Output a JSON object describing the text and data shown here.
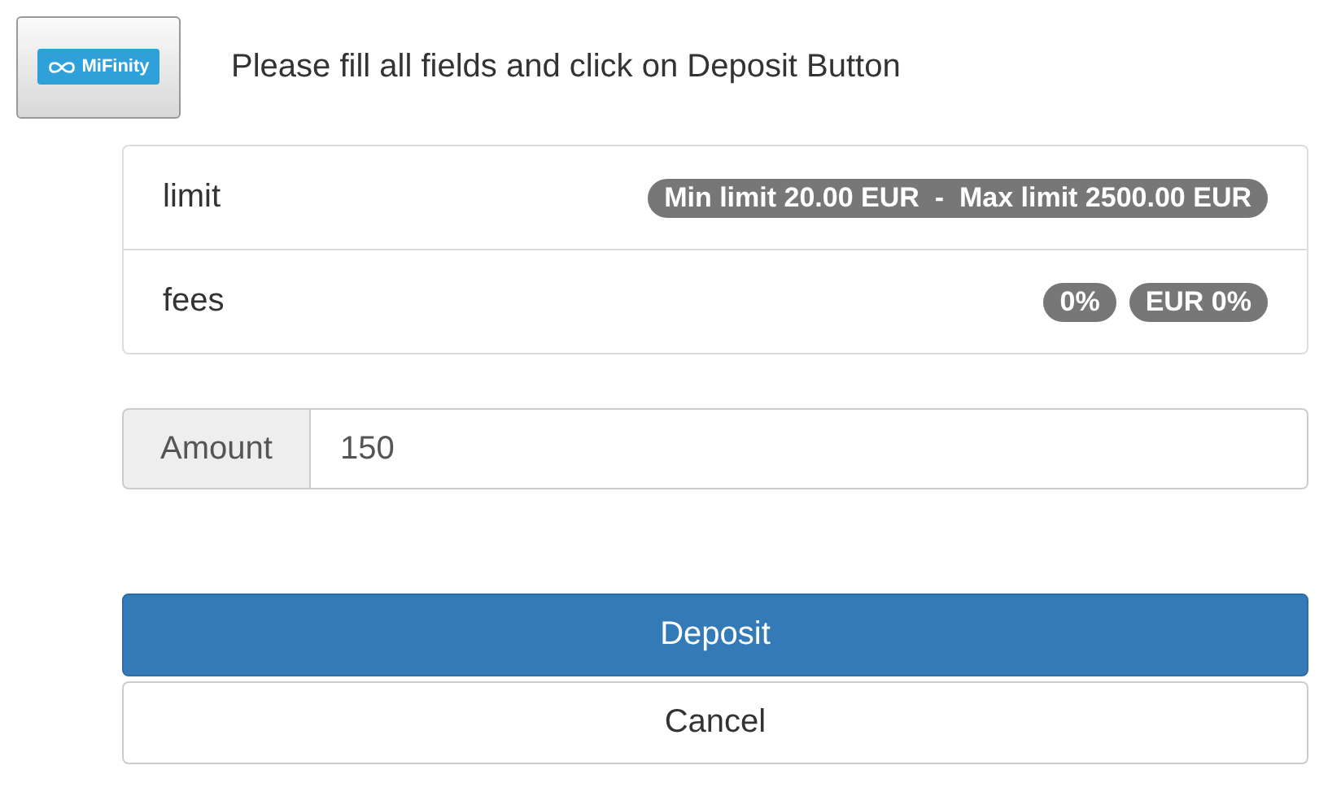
{
  "header": {
    "logo_text": "MiFinity",
    "instruction": "Please fill all fields and click on Deposit Button"
  },
  "info_rows": [
    {
      "label": "limit",
      "badges": [
        "Min limit 20.00 EUR  -  Max limit 2500.00 EUR"
      ]
    },
    {
      "label": "fees",
      "badges": [
        "0%",
        "EUR 0%"
      ]
    }
  ],
  "amount": {
    "label": "Amount",
    "value": "150"
  },
  "buttons": [
    {
      "label": "Deposit",
      "kind": "primary"
    },
    {
      "label": "Cancel",
      "kind": "default"
    }
  ]
}
